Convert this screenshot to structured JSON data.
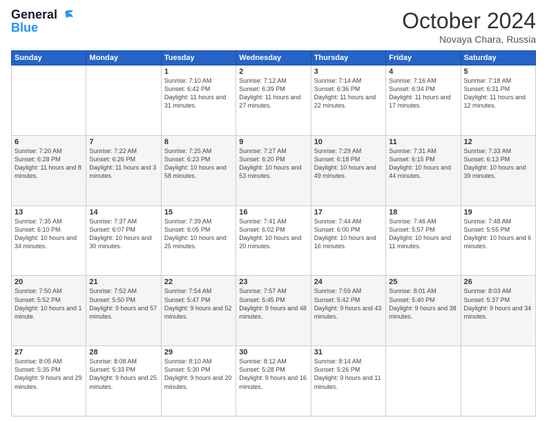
{
  "header": {
    "logo_line1": "General",
    "logo_line2": "Blue",
    "month": "October 2024",
    "location": "Novaya Chara, Russia"
  },
  "weekdays": [
    "Sunday",
    "Monday",
    "Tuesday",
    "Wednesday",
    "Thursday",
    "Friday",
    "Saturday"
  ],
  "weeks": [
    [
      {
        "day": "",
        "sunrise": "",
        "sunset": "",
        "daylight": ""
      },
      {
        "day": "",
        "sunrise": "",
        "sunset": "",
        "daylight": ""
      },
      {
        "day": "1",
        "sunrise": "Sunrise: 7:10 AM",
        "sunset": "Sunset: 6:42 PM",
        "daylight": "Daylight: 11 hours and 31 minutes."
      },
      {
        "day": "2",
        "sunrise": "Sunrise: 7:12 AM",
        "sunset": "Sunset: 6:39 PM",
        "daylight": "Daylight: 11 hours and 27 minutes."
      },
      {
        "day": "3",
        "sunrise": "Sunrise: 7:14 AM",
        "sunset": "Sunset: 6:36 PM",
        "daylight": "Daylight: 11 hours and 22 minutes."
      },
      {
        "day": "4",
        "sunrise": "Sunrise: 7:16 AM",
        "sunset": "Sunset: 6:34 PM",
        "daylight": "Daylight: 11 hours and 17 minutes."
      },
      {
        "day": "5",
        "sunrise": "Sunrise: 7:18 AM",
        "sunset": "Sunset: 6:31 PM",
        "daylight": "Daylight: 11 hours and 12 minutes."
      }
    ],
    [
      {
        "day": "6",
        "sunrise": "Sunrise: 7:20 AM",
        "sunset": "Sunset: 6:28 PM",
        "daylight": "Daylight: 11 hours and 8 minutes."
      },
      {
        "day": "7",
        "sunrise": "Sunrise: 7:22 AM",
        "sunset": "Sunset: 6:26 PM",
        "daylight": "Daylight: 11 hours and 3 minutes."
      },
      {
        "day": "8",
        "sunrise": "Sunrise: 7:25 AM",
        "sunset": "Sunset: 6:23 PM",
        "daylight": "Daylight: 10 hours and 58 minutes."
      },
      {
        "day": "9",
        "sunrise": "Sunrise: 7:27 AM",
        "sunset": "Sunset: 6:20 PM",
        "daylight": "Daylight: 10 hours and 53 minutes."
      },
      {
        "day": "10",
        "sunrise": "Sunrise: 7:29 AM",
        "sunset": "Sunset: 6:18 PM",
        "daylight": "Daylight: 10 hours and 49 minutes."
      },
      {
        "day": "11",
        "sunrise": "Sunrise: 7:31 AM",
        "sunset": "Sunset: 6:15 PM",
        "daylight": "Daylight: 10 hours and 44 minutes."
      },
      {
        "day": "12",
        "sunrise": "Sunrise: 7:33 AM",
        "sunset": "Sunset: 6:13 PM",
        "daylight": "Daylight: 10 hours and 39 minutes."
      }
    ],
    [
      {
        "day": "13",
        "sunrise": "Sunrise: 7:35 AM",
        "sunset": "Sunset: 6:10 PM",
        "daylight": "Daylight: 10 hours and 34 minutes."
      },
      {
        "day": "14",
        "sunrise": "Sunrise: 7:37 AM",
        "sunset": "Sunset: 6:07 PM",
        "daylight": "Daylight: 10 hours and 30 minutes."
      },
      {
        "day": "15",
        "sunrise": "Sunrise: 7:39 AM",
        "sunset": "Sunset: 6:05 PM",
        "daylight": "Daylight: 10 hours and 25 minutes."
      },
      {
        "day": "16",
        "sunrise": "Sunrise: 7:41 AM",
        "sunset": "Sunset: 6:02 PM",
        "daylight": "Daylight: 10 hours and 20 minutes."
      },
      {
        "day": "17",
        "sunrise": "Sunrise: 7:44 AM",
        "sunset": "Sunset: 6:00 PM",
        "daylight": "Daylight: 10 hours and 16 minutes."
      },
      {
        "day": "18",
        "sunrise": "Sunrise: 7:46 AM",
        "sunset": "Sunset: 5:57 PM",
        "daylight": "Daylight: 10 hours and 11 minutes."
      },
      {
        "day": "19",
        "sunrise": "Sunrise: 7:48 AM",
        "sunset": "Sunset: 5:55 PM",
        "daylight": "Daylight: 10 hours and 6 minutes."
      }
    ],
    [
      {
        "day": "20",
        "sunrise": "Sunrise: 7:50 AM",
        "sunset": "Sunset: 5:52 PM",
        "daylight": "Daylight: 10 hours and 1 minute."
      },
      {
        "day": "21",
        "sunrise": "Sunrise: 7:52 AM",
        "sunset": "Sunset: 5:50 PM",
        "daylight": "Daylight: 9 hours and 57 minutes."
      },
      {
        "day": "22",
        "sunrise": "Sunrise: 7:54 AM",
        "sunset": "Sunset: 5:47 PM",
        "daylight": "Daylight: 9 hours and 52 minutes."
      },
      {
        "day": "23",
        "sunrise": "Sunrise: 7:57 AM",
        "sunset": "Sunset: 5:45 PM",
        "daylight": "Daylight: 9 hours and 48 minutes."
      },
      {
        "day": "24",
        "sunrise": "Sunrise: 7:59 AM",
        "sunset": "Sunset: 5:42 PM",
        "daylight": "Daylight: 9 hours and 43 minutes."
      },
      {
        "day": "25",
        "sunrise": "Sunrise: 8:01 AM",
        "sunset": "Sunset: 5:40 PM",
        "daylight": "Daylight: 9 hours and 38 minutes."
      },
      {
        "day": "26",
        "sunrise": "Sunrise: 8:03 AM",
        "sunset": "Sunset: 5:37 PM",
        "daylight": "Daylight: 9 hours and 34 minutes."
      }
    ],
    [
      {
        "day": "27",
        "sunrise": "Sunrise: 8:05 AM",
        "sunset": "Sunset: 5:35 PM",
        "daylight": "Daylight: 9 hours and 29 minutes."
      },
      {
        "day": "28",
        "sunrise": "Sunrise: 8:08 AM",
        "sunset": "Sunset: 5:33 PM",
        "daylight": "Daylight: 9 hours and 25 minutes."
      },
      {
        "day": "29",
        "sunrise": "Sunrise: 8:10 AM",
        "sunset": "Sunset: 5:30 PM",
        "daylight": "Daylight: 9 hours and 20 minutes."
      },
      {
        "day": "30",
        "sunrise": "Sunrise: 8:12 AM",
        "sunset": "Sunset: 5:28 PM",
        "daylight": "Daylight: 9 hours and 16 minutes."
      },
      {
        "day": "31",
        "sunrise": "Sunrise: 8:14 AM",
        "sunset": "Sunset: 5:26 PM",
        "daylight": "Daylight: 9 hours and 11 minutes."
      },
      {
        "day": "",
        "sunrise": "",
        "sunset": "",
        "daylight": ""
      },
      {
        "day": "",
        "sunrise": "",
        "sunset": "",
        "daylight": ""
      }
    ]
  ]
}
